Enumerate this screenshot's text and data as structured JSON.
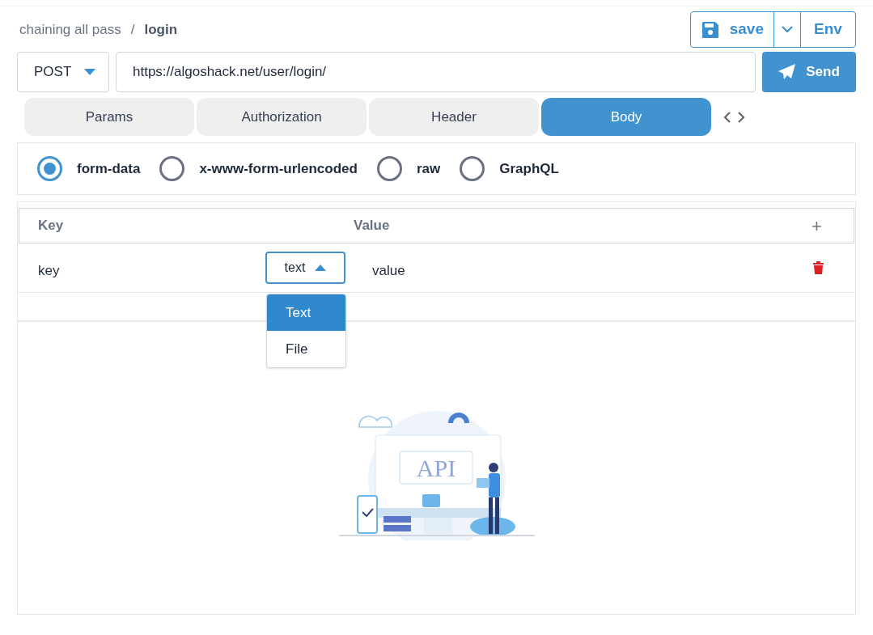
{
  "breadcrumb": {
    "parent": "chaining all pass",
    "separator": "/",
    "current": "login"
  },
  "toolbar": {
    "save": "save",
    "env": "Env"
  },
  "request": {
    "method": "POST",
    "url": "https://algoshack.net/user/login/",
    "send": "Send"
  },
  "tabs": [
    {
      "label": "Params",
      "selected": false
    },
    {
      "label": "Authorization",
      "selected": false
    },
    {
      "label": "Header",
      "selected": false
    },
    {
      "label": "Body",
      "selected": true
    }
  ],
  "body_types": [
    {
      "label": "form-data",
      "selected": true
    },
    {
      "label": "x-www-form-urlencoded",
      "selected": false
    },
    {
      "label": "raw",
      "selected": false
    },
    {
      "label": "GraphQL",
      "selected": false
    }
  ],
  "table": {
    "columns": [
      "Key",
      "Value"
    ],
    "add": "+",
    "rows": [
      {
        "key": "key",
        "type": "text",
        "value": "value",
        "dropdown_open": true
      }
    ]
  },
  "type_menu": [
    {
      "label": "Text",
      "selected": true
    },
    {
      "label": "File",
      "selected": false
    }
  ],
  "illustration": {
    "label": "API"
  }
}
